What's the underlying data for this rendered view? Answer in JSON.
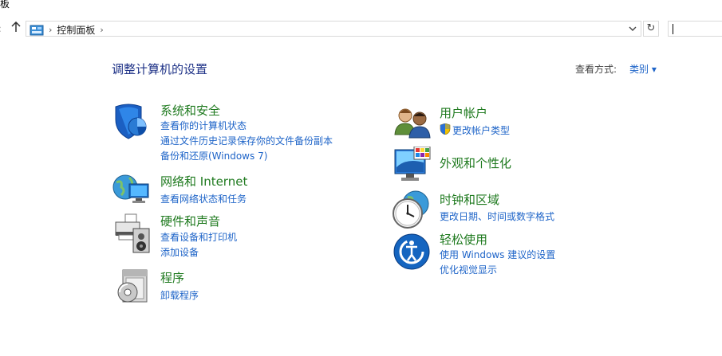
{
  "window": {
    "title_fragment": "板"
  },
  "nav": {
    "back_icon": "back-arrow-icon",
    "up_icon": "up-arrow-icon"
  },
  "address": {
    "crumb": "控制面板",
    "separator": "›",
    "dropdown_icon": "chevron-down-icon",
    "refresh_icon": "refresh-icon"
  },
  "search": {
    "value": ""
  },
  "header": {
    "title": "调整计算机的设置",
    "view_label": "查看方式:",
    "view_value": "类别 ▾"
  },
  "categories_left": [
    {
      "title": "系统和安全",
      "icon": "shield-icon",
      "links": [
        "查看你的计算机状态",
        "通过文件历史记录保存你的文件备份副本",
        "备份和还原(Windows 7)"
      ]
    },
    {
      "title": "网络和 Internet",
      "icon": "network-globe-icon",
      "links": [
        "查看网络状态和任务"
      ]
    },
    {
      "title": "硬件和声音",
      "icon": "printer-speaker-icon",
      "links": [
        "查看设备和打印机",
        "添加设备"
      ]
    },
    {
      "title": "程序",
      "icon": "programs-disc-icon",
      "links": [
        "卸载程序"
      ]
    }
  ],
  "categories_right": [
    {
      "title": "用户帐户",
      "icon": "users-icon",
      "links": [
        "更改帐户类型"
      ],
      "link_icon": "uac-shield-icon"
    },
    {
      "title": "外观和个性化",
      "icon": "monitor-palette-icon",
      "links": []
    },
    {
      "title": "时钟和区域",
      "icon": "clock-globe-icon",
      "links": [
        "更改日期、时间或数字格式"
      ]
    },
    {
      "title": "轻松使用",
      "icon": "ease-of-access-icon",
      "links": [
        "使用 Windows 建议的设置",
        "优化视觉显示"
      ]
    }
  ]
}
